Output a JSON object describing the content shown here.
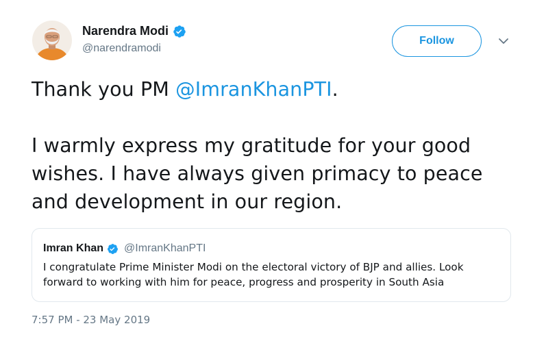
{
  "author": {
    "name": "Narendra Modi",
    "handle": "@narendramodi",
    "verified": true
  },
  "follow_button": {
    "label": "Follow"
  },
  "tweet": {
    "line1_prefix": "Thank you PM ",
    "line1_mention": "@ImranKhanPTI",
    "line1_suffix": ".",
    "paragraph2": "I warmly express my gratitude for your good wishes. I have always given primacy to peace and development in our region."
  },
  "quoted_tweet": {
    "name": "Imran Khan",
    "handle": "@ImranKhanPTI",
    "verified": true,
    "text": "I congratulate Prime Minister Modi on the electoral victory of BJP and allies. Look forward to working with him for peace, progress and prosperity in South Asia"
  },
  "timestamp": "7:57 PM - 23 May 2019",
  "colors": {
    "link": "#1b95e0",
    "secondary_text": "#657786",
    "border": "#e1e8ed",
    "verified": "#1da1f2"
  },
  "icons": {
    "verified": "verified-badge-icon",
    "caret": "chevron-down-icon"
  }
}
